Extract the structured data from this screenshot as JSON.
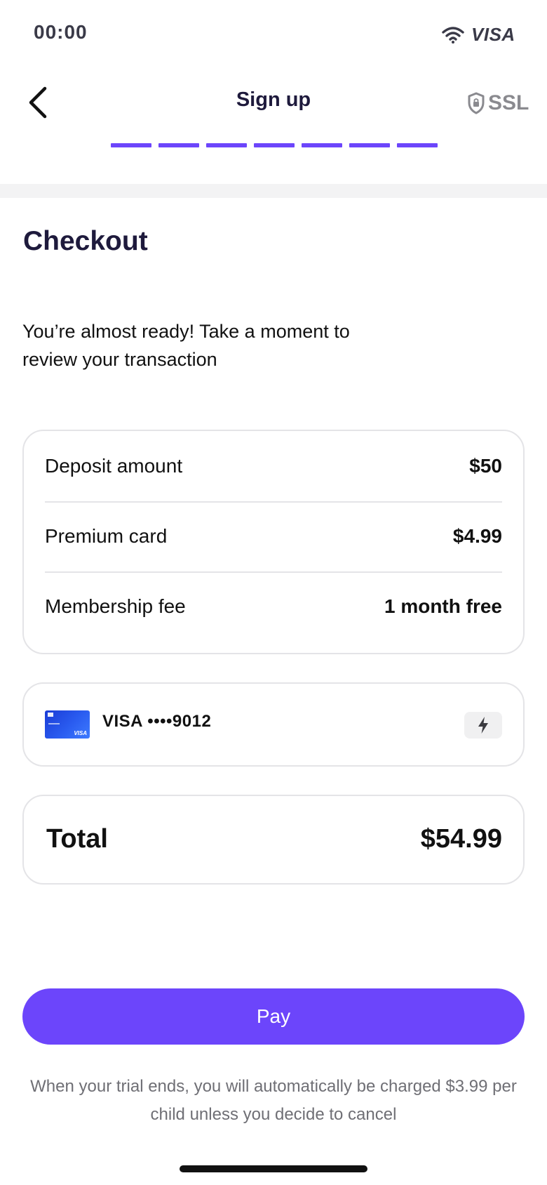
{
  "status_bar": {
    "time": "00:00",
    "brand": "VISA",
    "wifi_icon": "wifi-icon"
  },
  "header": {
    "back_icon": "chevron-left-icon",
    "title": "Sign up",
    "ssl_icon": "shield-lock-icon",
    "ssl_label": "SSL",
    "progress": {
      "completed_steps": 7,
      "total_steps": 7,
      "color": "#6c45fb"
    }
  },
  "page": {
    "title": "Checkout",
    "intro": "You’re almost ready! Take a moment to review your transaction"
  },
  "summary": {
    "rows": [
      {
        "label": "Deposit amount",
        "value": "$50"
      },
      {
        "label": "Premium card",
        "value": "$4.99"
      },
      {
        "label": "Membership fee",
        "value": "1 month free"
      }
    ]
  },
  "payment_method": {
    "card_icon": "visa-card-icon",
    "label": "VISA ••••9012",
    "action_icon": "lightning-bolt-icon"
  },
  "total": {
    "label": "Total",
    "value": "$54.99"
  },
  "actions": {
    "pay_label": "Pay",
    "pay_color": "#6c45fb"
  },
  "footnote": "When your trial ends, you will automatically be charged $3.99 per child unless you decide to cancel"
}
